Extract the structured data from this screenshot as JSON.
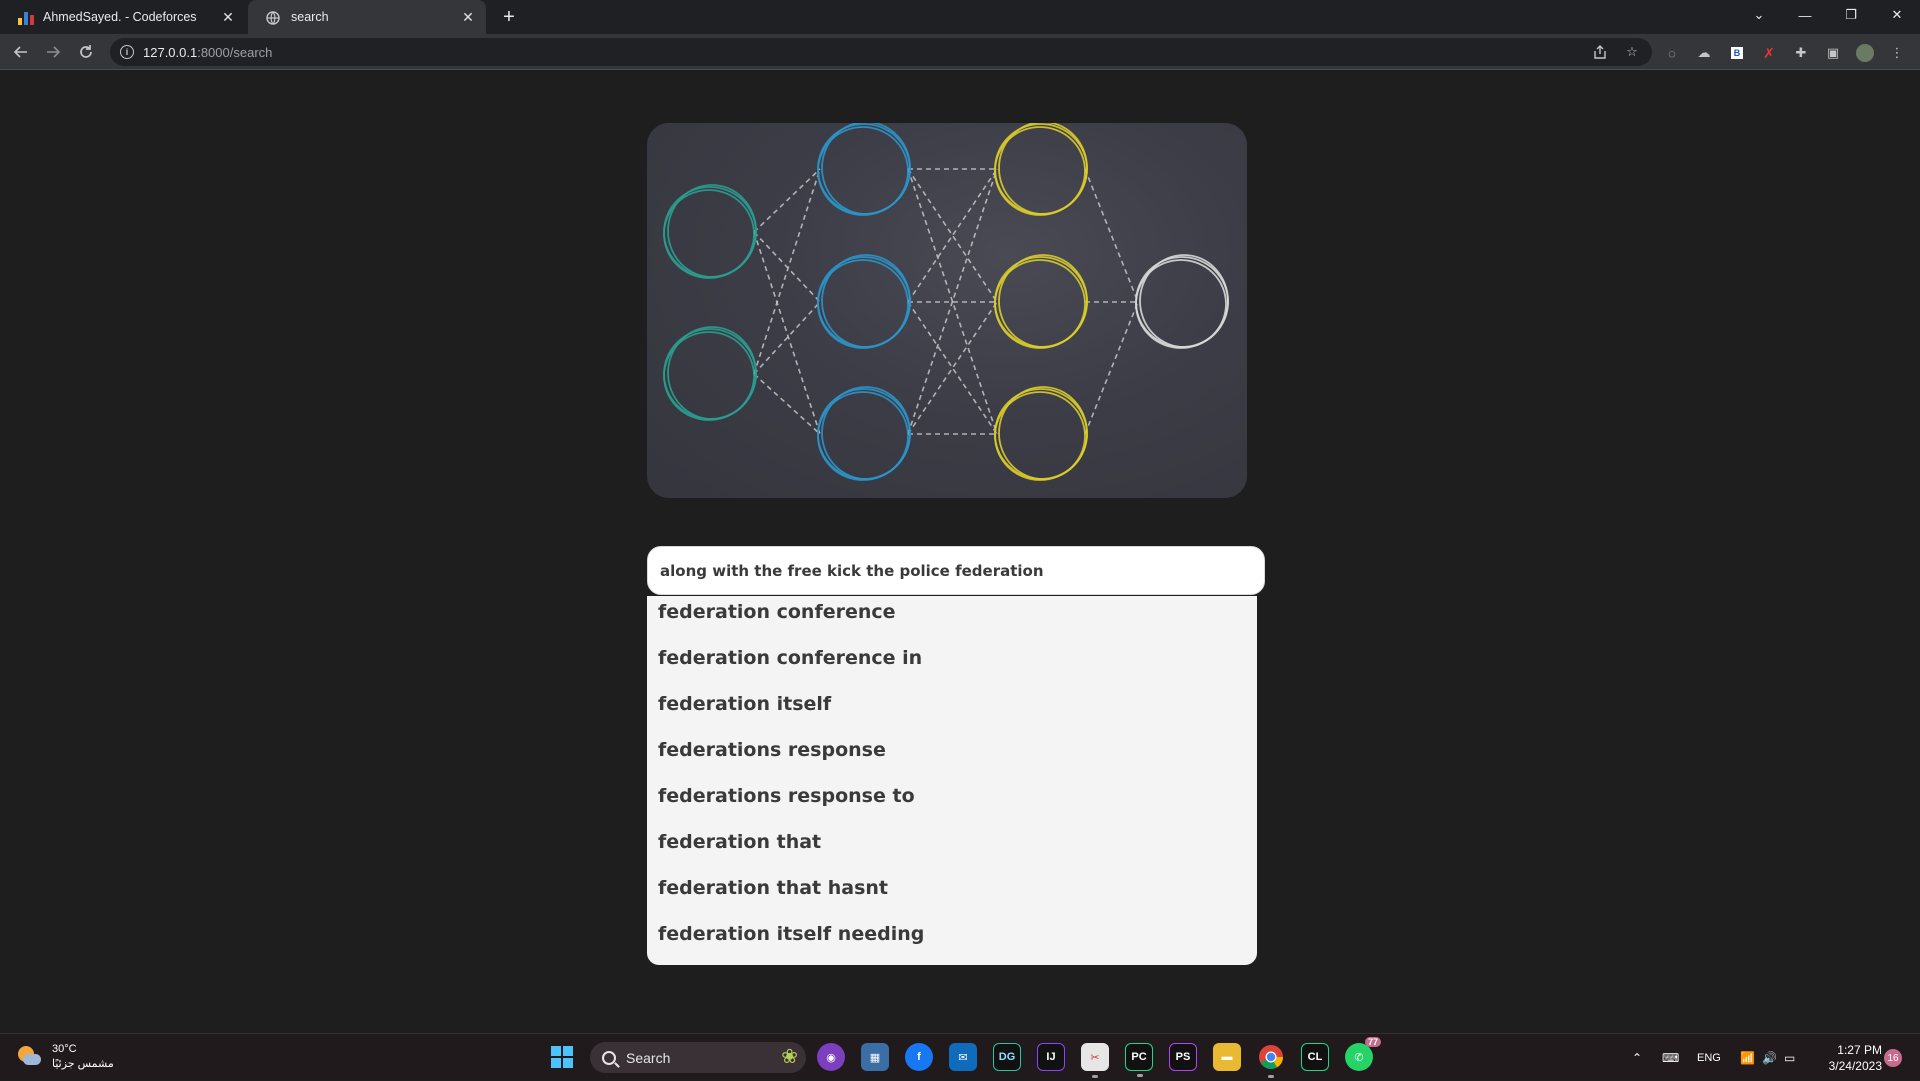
{
  "browser": {
    "tabs": [
      {
        "title": "AhmedSayed. - Codeforces",
        "active": false,
        "icon": "codeforces-icon"
      },
      {
        "title": "search",
        "active": true,
        "icon": "globe-icon"
      }
    ],
    "new_tab_label": "+",
    "url_host": "127.0.0.1",
    "url_path": ":8000/search"
  },
  "search": {
    "value": "along with the free kick the police federation",
    "placeholder": ""
  },
  "suggestions": [
    "federation conference",
    "federation conference in",
    "federation itself",
    "federations response",
    "federations response to",
    "federation that",
    "federation that hasnt",
    "federation itself needing"
  ],
  "colors": {
    "input_layer": "#2a9d8f",
    "hidden_layer_1": "#2b95c9",
    "hidden_layer_2": "#d9cc2b",
    "output_layer": "#d8d8d8",
    "edge": "#d0d0d0"
  },
  "taskbar": {
    "weather_temp": "30°C",
    "weather_desc": "مشمس جزئيًا",
    "search_label": "Search",
    "language": "ENG",
    "time": "1:27 PM",
    "date": "3/24/2023",
    "notification_count": "16",
    "whatsapp_badge": "77"
  }
}
